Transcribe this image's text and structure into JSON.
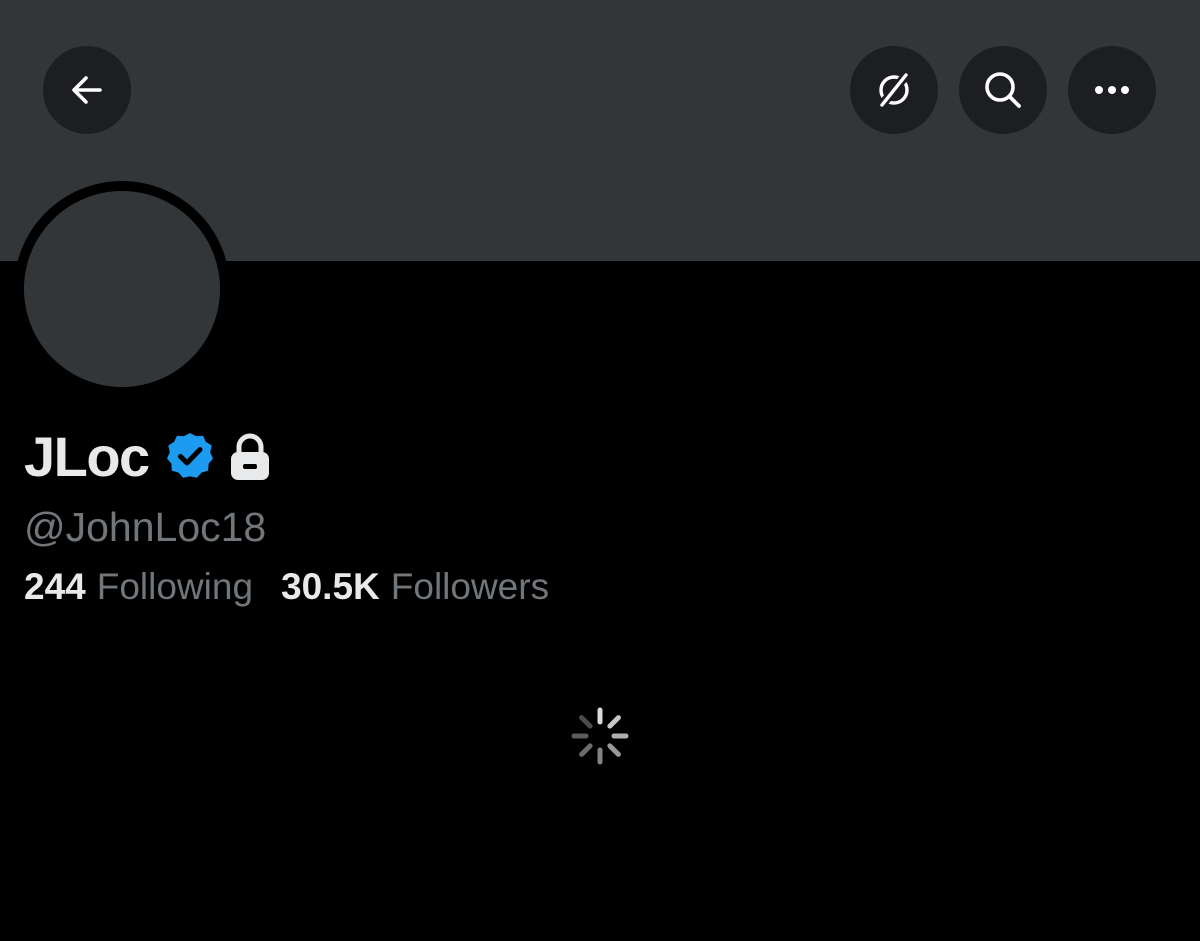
{
  "profile": {
    "display_name": "JLoc",
    "handle": "@JohnLoc18",
    "verified": true,
    "protected": true
  },
  "stats": {
    "following_count": "244",
    "following_label": "Following",
    "followers_count": "30.5K",
    "followers_label": "Followers"
  },
  "header": {
    "buttons": [
      "back-arrow-icon",
      "grok-icon",
      "search-icon",
      "more-icon"
    ]
  },
  "colors": {
    "background": "#000000",
    "banner": "#333639",
    "button_bg": "#1c1e21",
    "primary_text": "#e7e9ea",
    "secondary_text": "#71767b",
    "verified_blue": "#1d9bf0"
  },
  "loading": true
}
